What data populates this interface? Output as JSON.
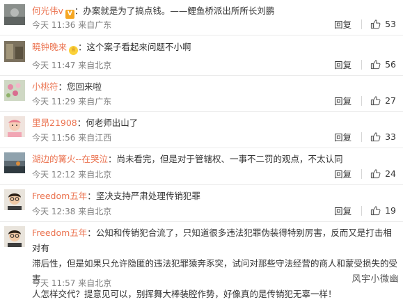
{
  "comments": [
    {
      "username": "何光伟v",
      "badge": "V",
      "text": "办案就是为了搞点钱。——鲤鱼桥派出所所长刘鹏",
      "time_location": "今天 11:36 来自广东",
      "reply_label": "回复",
      "likes": "53"
    },
    {
      "username": "曉钟晚来",
      "badge": "♕",
      "text": "这个案子看起来问题不小啊",
      "time_location": "今天 11:47 来自北京",
      "reply_label": "回复",
      "likes": "56"
    },
    {
      "username": "小桃符",
      "text": "您回来啦",
      "time_location": "今天 11:29 来自广东",
      "reply_label": "回复",
      "likes": "27"
    },
    {
      "username": "里昂21908",
      "text": "何老师出山了",
      "time_location": "今天 11:56 来自江西",
      "reply_label": "回复",
      "likes": "33"
    },
    {
      "username": "湖边的篝火--在哭泣",
      "text": "尚未看完，但是对于管辖权、一事不二罚的观点，不太认同",
      "time_location": "今天 12:12 来自北京",
      "reply_label": "回复",
      "likes": "24"
    },
    {
      "username": "Freedom五年",
      "text": "坚决支持严肃处理传销犯罪",
      "time_location": "今天 12:38 来自北京",
      "reply_label": "回复",
      "likes": "19"
    },
    {
      "username": "Freedom五年",
      "text_lines": [
        "公知和传销犯合流了，只知道很多违法犯罪伪装得特别厉害，反而又是打击相对有",
        "滞后性，但是如果只允许隐匿的违法犯罪猿奔豕突，试问对那些守法经营的商人和蒙受损失的受害",
        "人怎样交代？提意见可以，别挥舞大棒装腔作势，好像真的是传销犯无辜一样！"
      ],
      "time_location": "今天 11:57 来自北京",
      "watermark": "风宇小微幽"
    }
  ]
}
